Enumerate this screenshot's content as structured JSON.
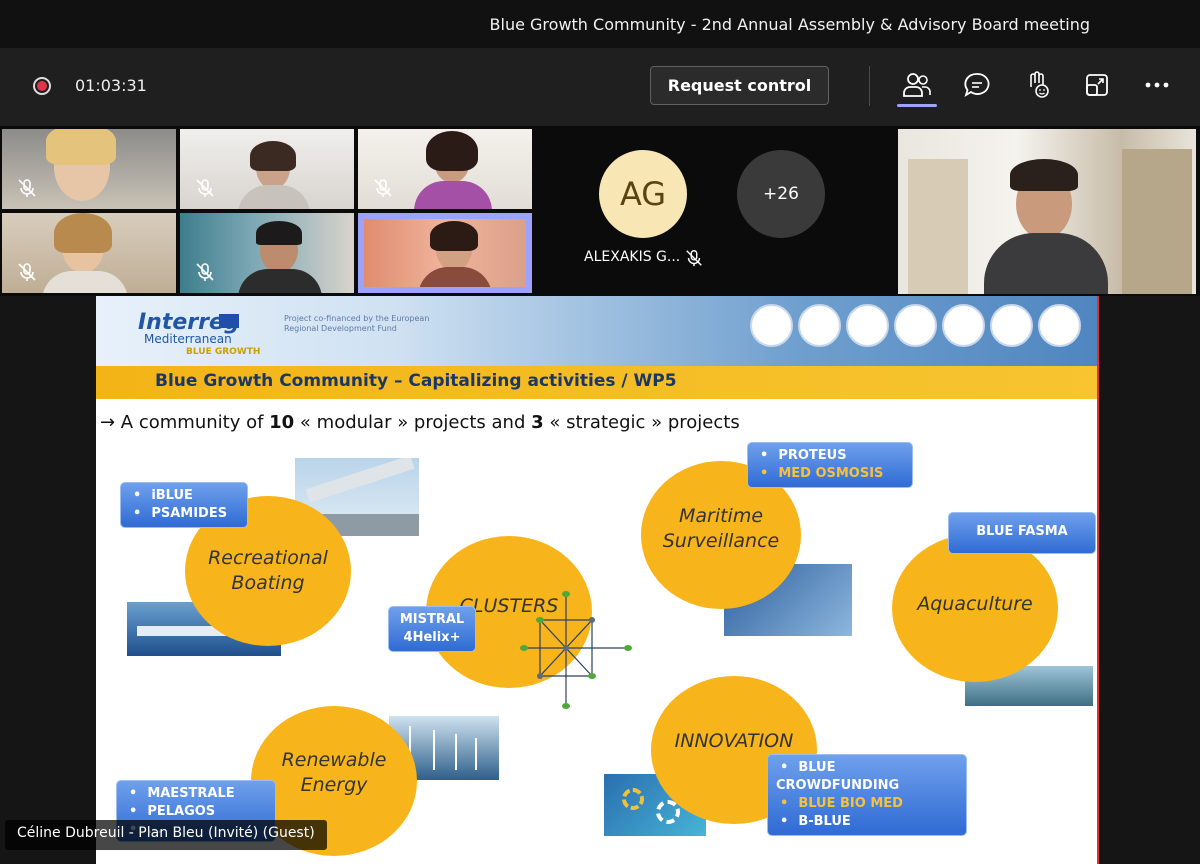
{
  "window": {
    "title": "Blue Growth Community - 2nd Annual Assembly & Advisory Board meeting"
  },
  "toolbar": {
    "timer": "01:03:31",
    "request_control_label": "Request control",
    "icons": [
      "people-icon",
      "chat-icon",
      "raise-hand-icon",
      "share-icon",
      "more-icon"
    ]
  },
  "participants": {
    "avatar_initials": "AG",
    "avatar_name": "ALEXAKIS G...",
    "more_count": "+26",
    "presenter_name": "Céline Dubreuil - Plan Bleu (Invité) (Guest)"
  },
  "slide": {
    "logo_text": "Interreg",
    "logo_sub": "Mediterranean",
    "logo_tag": "BLUE GROWTH",
    "cofinance": "Project co-financed by the European Regional Development Fund",
    "title": "Blue Growth Community – Capitalizing activities / WP5",
    "subtitle_pre": "→ A community of ",
    "subtitle_n1": "10",
    "subtitle_mid": " « modular » projects and ",
    "subtitle_n2": "3",
    "subtitle_post": " « strategic » projects",
    "blobs": {
      "recreational": "Recreational Boating",
      "clusters": "CLUSTERS",
      "maritime": "Maritime Surveillance",
      "aquaculture": "Aquaculture",
      "renewable": "Renewable Energy",
      "innovation": "INNOVATION"
    },
    "badges": {
      "recreational": [
        "iBLUE",
        "PSAMIDES"
      ],
      "clusters": [
        "MISTRAL",
        "4Helix+"
      ],
      "maritime": [
        "PROTEUS",
        "MED OSMOSIS"
      ],
      "aquaculture": "BLUE FASMA",
      "renewable": [
        "MAESTRALE",
        "PELAGOS",
        "..."
      ],
      "innovation": [
        "BLUE CROWDFUNDING",
        "BLUE BIO MED",
        "B-BLUE"
      ]
    },
    "colors": {
      "yellow": "#f8b41b",
      "badge_blue": "#2f6bd4",
      "title_blue": "#1b3765"
    }
  }
}
